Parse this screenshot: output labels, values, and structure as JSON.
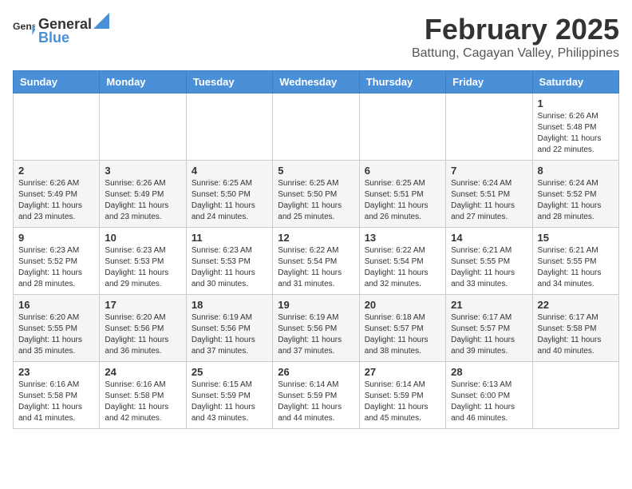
{
  "header": {
    "logo_general": "General",
    "logo_blue": "Blue",
    "month_year": "February 2025",
    "location": "Battung, Cagayan Valley, Philippines"
  },
  "weekdays": [
    "Sunday",
    "Monday",
    "Tuesday",
    "Wednesday",
    "Thursday",
    "Friday",
    "Saturday"
  ],
  "weeks": [
    [
      {
        "day": "",
        "info": ""
      },
      {
        "day": "",
        "info": ""
      },
      {
        "day": "",
        "info": ""
      },
      {
        "day": "",
        "info": ""
      },
      {
        "day": "",
        "info": ""
      },
      {
        "day": "",
        "info": ""
      },
      {
        "day": "1",
        "info": "Sunrise: 6:26 AM\nSunset: 5:48 PM\nDaylight: 11 hours\nand 22 minutes."
      }
    ],
    [
      {
        "day": "2",
        "info": "Sunrise: 6:26 AM\nSunset: 5:49 PM\nDaylight: 11 hours\nand 23 minutes."
      },
      {
        "day": "3",
        "info": "Sunrise: 6:26 AM\nSunset: 5:49 PM\nDaylight: 11 hours\nand 23 minutes."
      },
      {
        "day": "4",
        "info": "Sunrise: 6:25 AM\nSunset: 5:50 PM\nDaylight: 11 hours\nand 24 minutes."
      },
      {
        "day": "5",
        "info": "Sunrise: 6:25 AM\nSunset: 5:50 PM\nDaylight: 11 hours\nand 25 minutes."
      },
      {
        "day": "6",
        "info": "Sunrise: 6:25 AM\nSunset: 5:51 PM\nDaylight: 11 hours\nand 26 minutes."
      },
      {
        "day": "7",
        "info": "Sunrise: 6:24 AM\nSunset: 5:51 PM\nDaylight: 11 hours\nand 27 minutes."
      },
      {
        "day": "8",
        "info": "Sunrise: 6:24 AM\nSunset: 5:52 PM\nDaylight: 11 hours\nand 28 minutes."
      }
    ],
    [
      {
        "day": "9",
        "info": "Sunrise: 6:23 AM\nSunset: 5:52 PM\nDaylight: 11 hours\nand 28 minutes."
      },
      {
        "day": "10",
        "info": "Sunrise: 6:23 AM\nSunset: 5:53 PM\nDaylight: 11 hours\nand 29 minutes."
      },
      {
        "day": "11",
        "info": "Sunrise: 6:23 AM\nSunset: 5:53 PM\nDaylight: 11 hours\nand 30 minutes."
      },
      {
        "day": "12",
        "info": "Sunrise: 6:22 AM\nSunset: 5:54 PM\nDaylight: 11 hours\nand 31 minutes."
      },
      {
        "day": "13",
        "info": "Sunrise: 6:22 AM\nSunset: 5:54 PM\nDaylight: 11 hours\nand 32 minutes."
      },
      {
        "day": "14",
        "info": "Sunrise: 6:21 AM\nSunset: 5:55 PM\nDaylight: 11 hours\nand 33 minutes."
      },
      {
        "day": "15",
        "info": "Sunrise: 6:21 AM\nSunset: 5:55 PM\nDaylight: 11 hours\nand 34 minutes."
      }
    ],
    [
      {
        "day": "16",
        "info": "Sunrise: 6:20 AM\nSunset: 5:55 PM\nDaylight: 11 hours\nand 35 minutes."
      },
      {
        "day": "17",
        "info": "Sunrise: 6:20 AM\nSunset: 5:56 PM\nDaylight: 11 hours\nand 36 minutes."
      },
      {
        "day": "18",
        "info": "Sunrise: 6:19 AM\nSunset: 5:56 PM\nDaylight: 11 hours\nand 37 minutes."
      },
      {
        "day": "19",
        "info": "Sunrise: 6:19 AM\nSunset: 5:56 PM\nDaylight: 11 hours\nand 37 minutes."
      },
      {
        "day": "20",
        "info": "Sunrise: 6:18 AM\nSunset: 5:57 PM\nDaylight: 11 hours\nand 38 minutes."
      },
      {
        "day": "21",
        "info": "Sunrise: 6:17 AM\nSunset: 5:57 PM\nDaylight: 11 hours\nand 39 minutes."
      },
      {
        "day": "22",
        "info": "Sunrise: 6:17 AM\nSunset: 5:58 PM\nDaylight: 11 hours\nand 40 minutes."
      }
    ],
    [
      {
        "day": "23",
        "info": "Sunrise: 6:16 AM\nSunset: 5:58 PM\nDaylight: 11 hours\nand 41 minutes."
      },
      {
        "day": "24",
        "info": "Sunrise: 6:16 AM\nSunset: 5:58 PM\nDaylight: 11 hours\nand 42 minutes."
      },
      {
        "day": "25",
        "info": "Sunrise: 6:15 AM\nSunset: 5:59 PM\nDaylight: 11 hours\nand 43 minutes."
      },
      {
        "day": "26",
        "info": "Sunrise: 6:14 AM\nSunset: 5:59 PM\nDaylight: 11 hours\nand 44 minutes."
      },
      {
        "day": "27",
        "info": "Sunrise: 6:14 AM\nSunset: 5:59 PM\nDaylight: 11 hours\nand 45 minutes."
      },
      {
        "day": "28",
        "info": "Sunrise: 6:13 AM\nSunset: 6:00 PM\nDaylight: 11 hours\nand 46 minutes."
      },
      {
        "day": "",
        "info": ""
      }
    ]
  ]
}
